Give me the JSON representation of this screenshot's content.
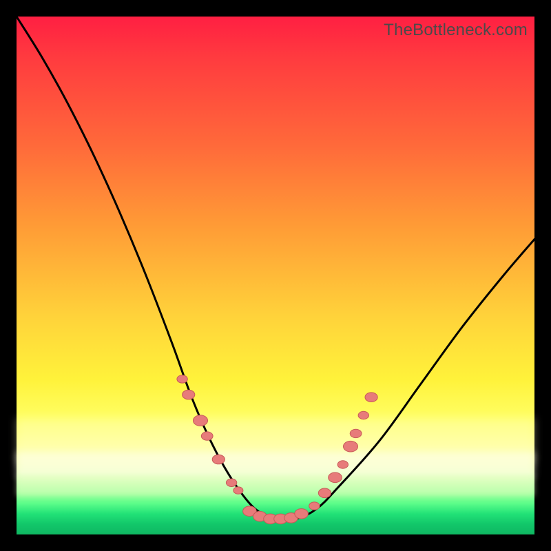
{
  "watermark": "TheBottleneck.com",
  "colors": {
    "marker_fill": "#e77b7a",
    "marker_stroke": "#c85a58",
    "curve_stroke": "#000000"
  },
  "chart_data": {
    "type": "line",
    "title": "",
    "xlabel": "",
    "ylabel": "",
    "xlim": [
      0,
      100
    ],
    "ylim": [
      0,
      100
    ],
    "grid": false,
    "legend": false,
    "series": [
      {
        "name": "bottleneck-curve",
        "x": [
          0,
          5,
          10,
          15,
          20,
          25,
          30,
          34,
          38,
          42,
          46,
          50,
          54,
          58,
          62,
          70,
          78,
          86,
          94,
          100
        ],
        "y": [
          100,
          92,
          83,
          73,
          62,
          50,
          37,
          26,
          17,
          10,
          5,
          3,
          3,
          5,
          9,
          18,
          29,
          40,
          50,
          57
        ]
      }
    ],
    "markers": [
      {
        "x": 32.0,
        "y": 30.0,
        "r": 1.1
      },
      {
        "x": 33.2,
        "y": 27.0,
        "r": 1.3
      },
      {
        "x": 35.5,
        "y": 22.0,
        "r": 1.5
      },
      {
        "x": 36.8,
        "y": 19.0,
        "r": 1.2
      },
      {
        "x": 39.0,
        "y": 14.5,
        "r": 1.3
      },
      {
        "x": 41.5,
        "y": 10.0,
        "r": 1.1
      },
      {
        "x": 42.8,
        "y": 8.5,
        "r": 1.0
      },
      {
        "x": 45.0,
        "y": 4.5,
        "r": 1.4
      },
      {
        "x": 47.0,
        "y": 3.5,
        "r": 1.4
      },
      {
        "x": 49.0,
        "y": 3.0,
        "r": 1.4
      },
      {
        "x": 51.0,
        "y": 3.0,
        "r": 1.4
      },
      {
        "x": 53.0,
        "y": 3.2,
        "r": 1.4
      },
      {
        "x": 55.0,
        "y": 4.0,
        "r": 1.4
      },
      {
        "x": 57.5,
        "y": 5.5,
        "r": 1.1
      },
      {
        "x": 59.5,
        "y": 8.0,
        "r": 1.3
      },
      {
        "x": 61.5,
        "y": 11.0,
        "r": 1.4
      },
      {
        "x": 63.0,
        "y": 13.5,
        "r": 1.1
      },
      {
        "x": 64.5,
        "y": 17.0,
        "r": 1.5
      },
      {
        "x": 65.5,
        "y": 19.5,
        "r": 1.2
      },
      {
        "x": 67.0,
        "y": 23.0,
        "r": 1.1
      },
      {
        "x": 68.5,
        "y": 26.5,
        "r": 1.3
      }
    ]
  }
}
